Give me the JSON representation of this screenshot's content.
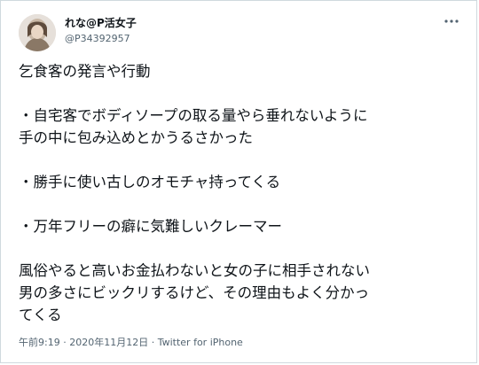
{
  "author": {
    "display_name": "れな@P活女子",
    "handle": "@P34392957"
  },
  "tweet": {
    "lines": [
      "乞食客の発言や行動",
      "",
      "・自宅客でボディソープの取る量やら垂れないように",
      "手の中に包み込めとかうるさかった",
      "",
      "・勝手に使い古しのオモチャ持ってくる",
      "",
      "・万年フリーの癖に気難しいクレーマー",
      "",
      "風俗やると高いお金払わないと女の子に相手されない",
      "男の多さにビックリするけど、その理由もよく分かっ",
      "てくる"
    ]
  },
  "meta": {
    "time": "午前9:19",
    "separator1": " · ",
    "date": "2020年11月12日",
    "separator2": " · ",
    "source": "Twitter for iPhone"
  },
  "icons": {
    "more": "more-horizontal-icon",
    "avatar": "avatar-photo"
  },
  "colors": {
    "text": "#0f1419",
    "secondary": "#536471",
    "border": "#cfd9de"
  }
}
